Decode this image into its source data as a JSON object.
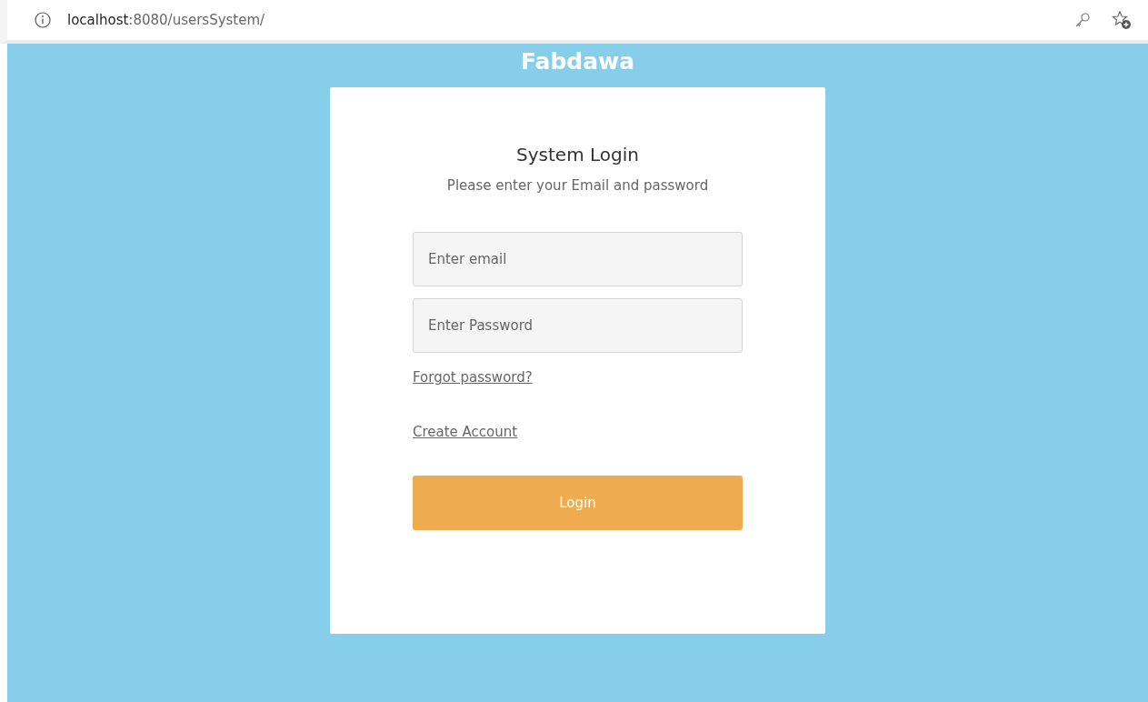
{
  "address_bar": {
    "host": "localhost",
    "path": ":8080/usersSystem/"
  },
  "brand": "Fabdawa",
  "login_card": {
    "title": "System Login",
    "subtitle": "Please enter your Email and password",
    "fields": [
      {
        "placeholder": "Enter email"
      },
      {
        "placeholder": "Enter Password"
      }
    ],
    "links": [
      "Forgot password?",
      "Create Account"
    ],
    "button": "Login"
  }
}
